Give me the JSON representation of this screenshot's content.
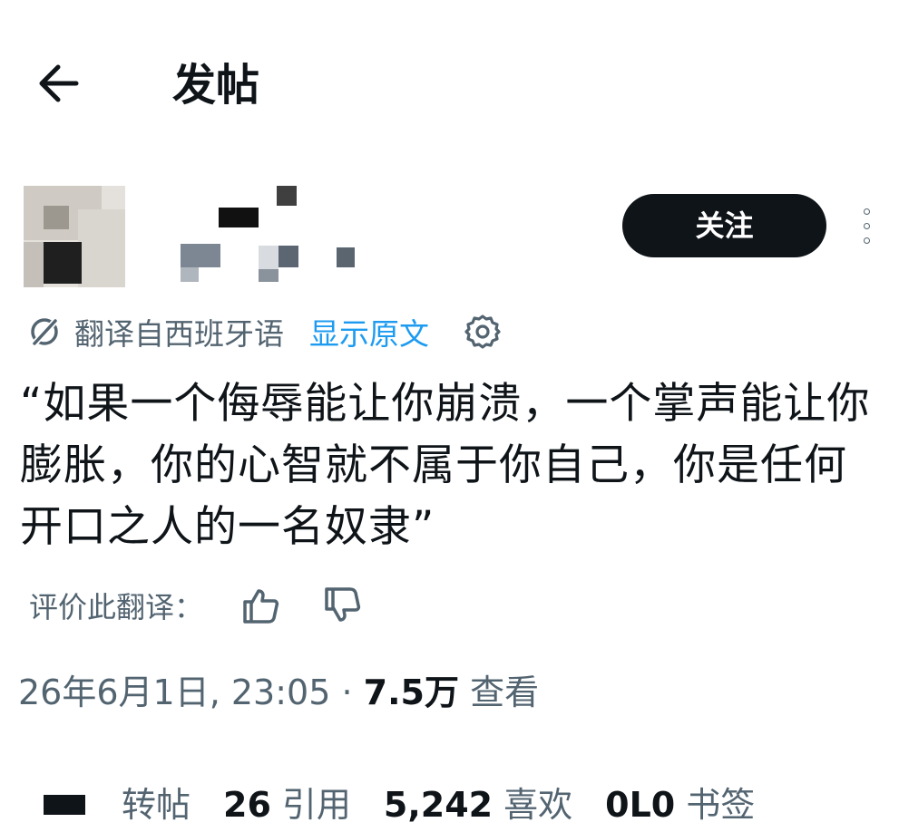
{
  "header": {
    "back_icon": "arrow-left-icon",
    "title": "发帖"
  },
  "author": {
    "follow_label": "关注",
    "more_icon": "more-vertical-icon"
  },
  "translation": {
    "icon": "translate-icon",
    "translated_from": "翻译自西班牙语",
    "show_original": "显示原文",
    "settings_icon": "gear-icon",
    "rate_label": "评价此翻译："
  },
  "post": {
    "text": "“如果一个侮辱能让你崩溃，一个掌声能让你膨胀，你的心智就不属于你自己，你是任何开口之人的一名奴隶”"
  },
  "meta": {
    "datetime": "26年6月1日, 23:05",
    "separator": " · ",
    "views": "7.5万",
    "views_label": "查看"
  },
  "stats": {
    "reposts_label": "转帖",
    "quotes": "26",
    "quotes_label": "引用",
    "likes": "5,242",
    "likes_label": "喜欢",
    "bookmarks": "0L0",
    "bookmarks_label": "书签"
  },
  "colors": {
    "text": "#0f1419",
    "secondary": "#536471",
    "link": "#1d9bf0",
    "button_bg": "#0f1419"
  }
}
